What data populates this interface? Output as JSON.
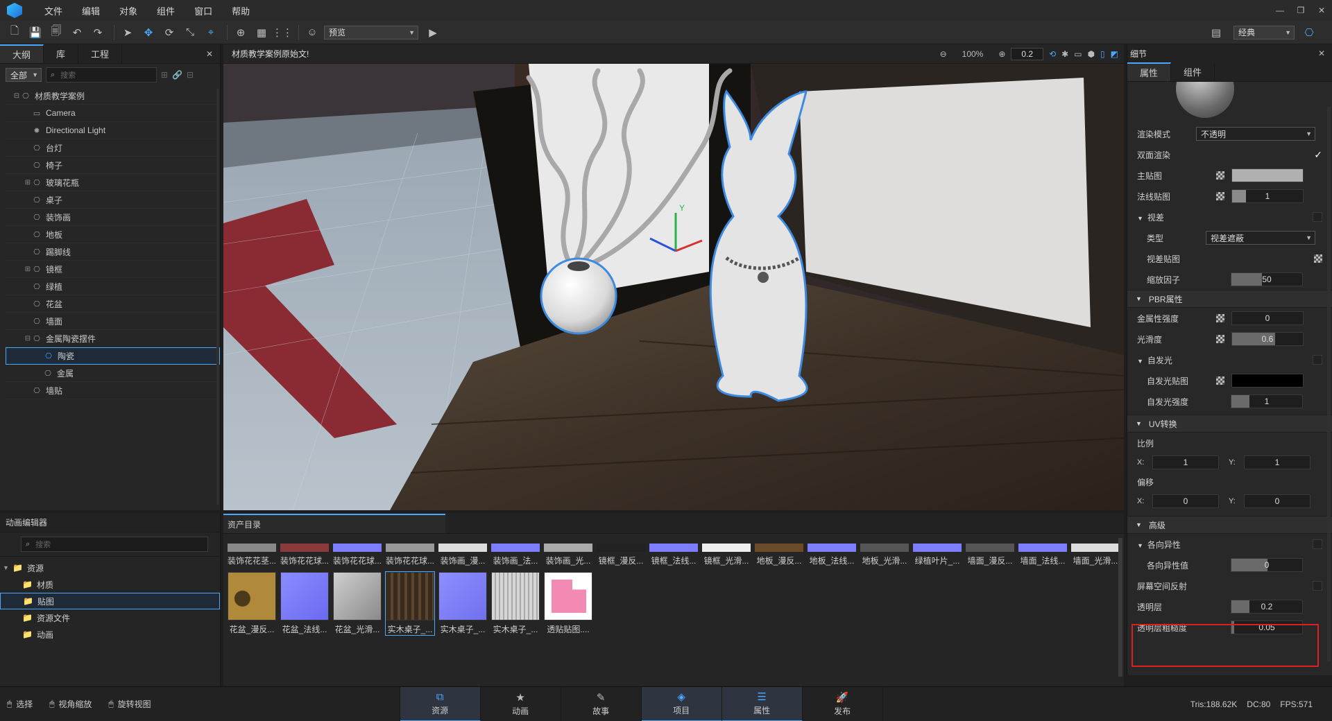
{
  "menu": {
    "items": [
      "文件",
      "编辑",
      "对象",
      "组件",
      "窗口",
      "帮助"
    ]
  },
  "toolbar": {
    "view_mode": "预览",
    "layout": "经典"
  },
  "outline": {
    "tabs": [
      "大纲",
      "库",
      "工程"
    ],
    "filter": "全部",
    "search_placeholder": "搜索",
    "items": [
      {
        "label": "材质教学案例",
        "icon": "object-icon"
      },
      {
        "label": "Camera",
        "icon": "camera-icon"
      },
      {
        "label": "Directional Light",
        "icon": "light-icon"
      },
      {
        "label": "台灯",
        "icon": "object-icon"
      },
      {
        "label": "椅子",
        "icon": "object-icon"
      },
      {
        "label": "玻璃花瓶",
        "icon": "object-icon"
      },
      {
        "label": "桌子",
        "icon": "object-icon"
      },
      {
        "label": "装饰画",
        "icon": "object-icon"
      },
      {
        "label": "地板",
        "icon": "object-icon"
      },
      {
        "label": "踢脚线",
        "icon": "object-icon"
      },
      {
        "label": "镜框",
        "icon": "object-icon"
      },
      {
        "label": "绿植",
        "icon": "object-icon"
      },
      {
        "label": "花盆",
        "icon": "object-icon"
      },
      {
        "label": "墙面",
        "icon": "object-icon"
      },
      {
        "label": "金属陶瓷摆件",
        "icon": "object-icon"
      },
      {
        "label": "陶瓷",
        "icon": "object-icon"
      },
      {
        "label": "金属",
        "icon": "object-icon"
      },
      {
        "label": "墙贴",
        "icon": "object-icon"
      }
    ]
  },
  "viewport": {
    "title": "材质教学案例原始文!",
    "zoom": "100%",
    "speed": "0.2"
  },
  "details": {
    "title": "细节",
    "tabs": [
      "属性",
      "组件"
    ],
    "render_mode_label": "渲染模式",
    "render_mode": "不透明",
    "double_sided_label": "双面渲染",
    "main_map_label": "主贴图",
    "normal_map_label": "法线贴图",
    "normal_map_value": "1",
    "parallax_label": "视差",
    "type_label": "类型",
    "type_value": "视差遮蔽",
    "parallax_map_label": "视差贴图",
    "scale_factor_label": "缩放因子",
    "scale_factor_value": "50",
    "pbr_label": "PBR属性",
    "metallic_label": "金属性强度",
    "metallic_value": "0",
    "smoothness_label": "光滑度",
    "smoothness_value": "0.6",
    "emission_label": "自发光",
    "emission_map_label": "自发光贴图",
    "emission_strength_label": "自发光强度",
    "emission_strength_value": "1",
    "uv_label": "UV转换",
    "scale_label": "比例",
    "scale_x": "1",
    "scale_y": "1",
    "offset_label": "偏移",
    "offset_x": "0",
    "offset_y": "0",
    "x_label": "X:",
    "y_label": "Y:",
    "advanced_label": "高级",
    "anisotropy_label": "各向异性",
    "anisotropy_value_label": "各向异性值",
    "anisotropy_value": "0",
    "ssr_label": "屏幕空间反射",
    "clearcoat_label": "透明层",
    "clearcoat_value": "0.2",
    "clearcoat_rough_label": "透明层粗糙度",
    "clearcoat_rough_value": "0.05"
  },
  "anim_editor": {
    "title": "动画编辑器",
    "search_placeholder": "搜索",
    "tree": [
      "资源",
      "材质",
      "贴图",
      "资源文件",
      "动画"
    ]
  },
  "assets": {
    "tab": "资产目录",
    "row1": [
      "装饰花花茎...",
      "装饰花花球...",
      "装饰花花球...",
      "装饰花花球...",
      "装饰画_漫...",
      "装饰画_法...",
      "装饰画_光...",
      "镜框_漫反...",
      "镜框_法线...",
      "镜框_光滑...",
      "地板_漫反...",
      "地板_法线...",
      "地板_光滑...",
      "绿植叶片_...",
      "墙面_漫反...",
      "墙面_法线...",
      "墙面_光滑..."
    ],
    "row2": [
      "花盆_漫反...",
      "花盆_法线...",
      "花盆_光滑...",
      "实木桌子_...",
      "实木桌子_...",
      "实木桌子_...",
      "透贴贴图...."
    ]
  },
  "status": {
    "select": "选择",
    "zoom": "视角缩放",
    "rotate": "旋转视图",
    "nav": [
      "资源",
      "动画",
      "故事",
      "项目",
      "属性",
      "发布"
    ],
    "tris": "Tris:188.62K",
    "dc": "DC:80",
    "fps": "FPS:571"
  }
}
